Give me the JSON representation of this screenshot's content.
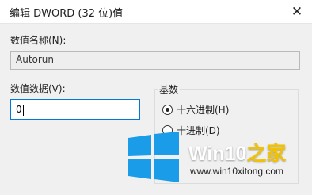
{
  "window": {
    "title": "编辑 DWORD (32 位)值",
    "close_glyph": "✕"
  },
  "name": {
    "label": "数值名称(N):",
    "value": "Autorun"
  },
  "value": {
    "label": "数值数据(V):",
    "text": "0"
  },
  "base": {
    "legend": "基数",
    "options": [
      {
        "label": "十六进制(H)",
        "selected": true
      },
      {
        "label": "十进制(D)",
        "selected": false
      }
    ]
  },
  "watermark": {
    "title_main": "Win10",
    "title_accent": "之家",
    "url": "www.win10xitong.com",
    "logo_color": "#1a9ce8",
    "accent_color": "#f2c200"
  }
}
